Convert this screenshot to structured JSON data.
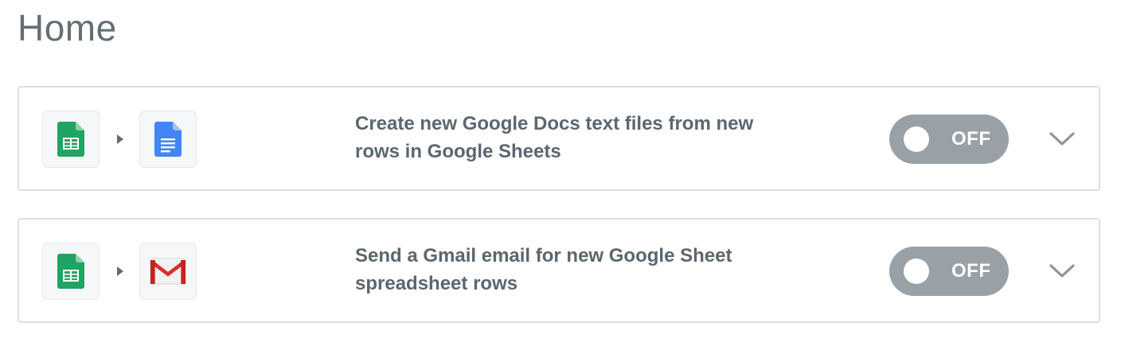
{
  "page": {
    "title": "Home"
  },
  "colors": {
    "toggle_off_bg": "#99a1a6",
    "sheets_green": "#1fa463",
    "docs_blue": "#4285f4",
    "gmail_red": "#d93025"
  },
  "zaps": [
    {
      "trigger_app_icon": "google-sheets-icon",
      "action_app_icon": "google-docs-icon",
      "title": "Create new Google Docs text files from new rows in Google Sheets",
      "toggle_label": "OFF",
      "enabled": false,
      "expand_icon": "chevron-down-icon"
    },
    {
      "trigger_app_icon": "google-sheets-icon",
      "action_app_icon": "gmail-icon",
      "title": "Send a Gmail email for new Google Sheet spreadsheet rows",
      "toggle_label": "OFF",
      "enabled": false,
      "expand_icon": "chevron-down-icon"
    }
  ]
}
